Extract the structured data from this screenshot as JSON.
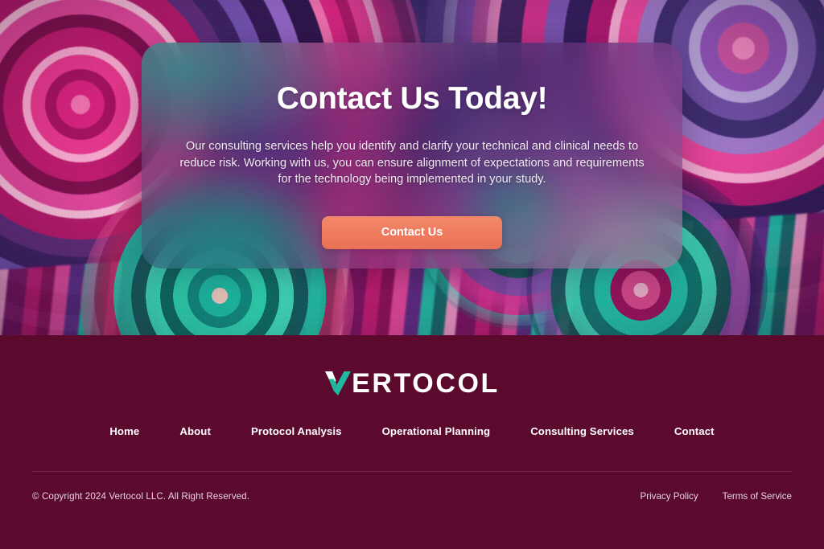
{
  "colors": {
    "footer_bg": "#5b0a2e",
    "cta_button": "#ee7a5e",
    "logo_accent": "#1fb9a0",
    "heading_text": "#ffffff",
    "divider": "rgba(255,255,255,0.13)"
  },
  "hero": {
    "background_description": "abstract 3d swirling ribbon artwork in magenta, pink, purple and teal",
    "card": {
      "title": "Contact Us Today!",
      "body": "Our consulting services help you identify and clarify your technical and clinical needs to reduce risk. Working with us, you can ensure alignment of expectations and requirements for the technology being implemented in your study.",
      "cta_label": "Contact Us"
    }
  },
  "footer": {
    "logo": {
      "word": "ERTOCOL",
      "mark": "checkmark-v-logo-icon",
      "full_text": "VERTOCOL"
    },
    "nav": [
      {
        "label": "Home"
      },
      {
        "label": "About"
      },
      {
        "label": "Protocol Analysis"
      },
      {
        "label": "Operational Planning"
      },
      {
        "label": "Consulting Services"
      },
      {
        "label": "Contact"
      }
    ],
    "copyright": "© Copyright 2024 Vertocol LLC. All Right Reserved.",
    "legal": [
      {
        "label": "Privacy Policy"
      },
      {
        "label": "Terms of Service"
      }
    ]
  }
}
